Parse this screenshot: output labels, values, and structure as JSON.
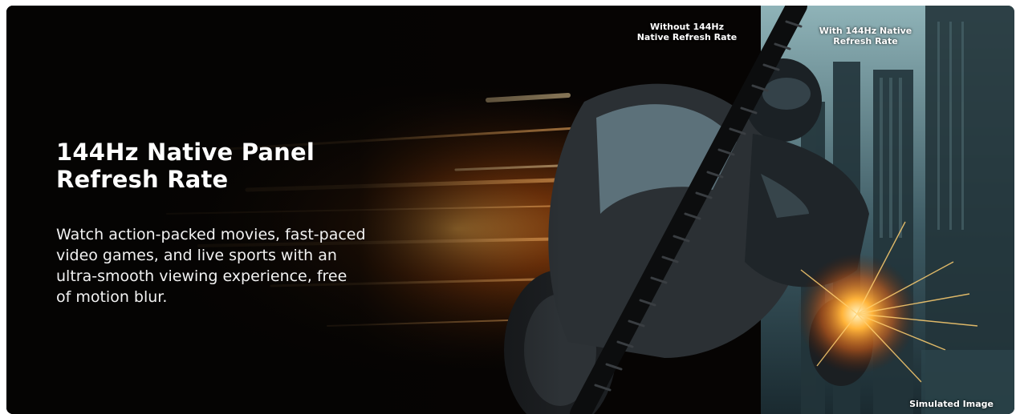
{
  "banner": {
    "heading_lines": [
      "144Hz Native Panel",
      "Refresh Rate"
    ],
    "body_lines": [
      "Watch action-packed movies, fast-paced",
      "video games, and live sports with an",
      "ultra-smooth viewing experience, free",
      "of motion blur."
    ],
    "label_without_lines": [
      "Without 144Hz",
      "Native Refresh Rate"
    ],
    "label_with_lines": [
      "With 144Hz Native",
      "Refresh Rate"
    ],
    "disclaimer": "Simulated Image"
  },
  "colors": {
    "background": "#050403",
    "text": "#ffffff",
    "glow": "#ff8a1e",
    "sky": "#7fa6ad"
  }
}
